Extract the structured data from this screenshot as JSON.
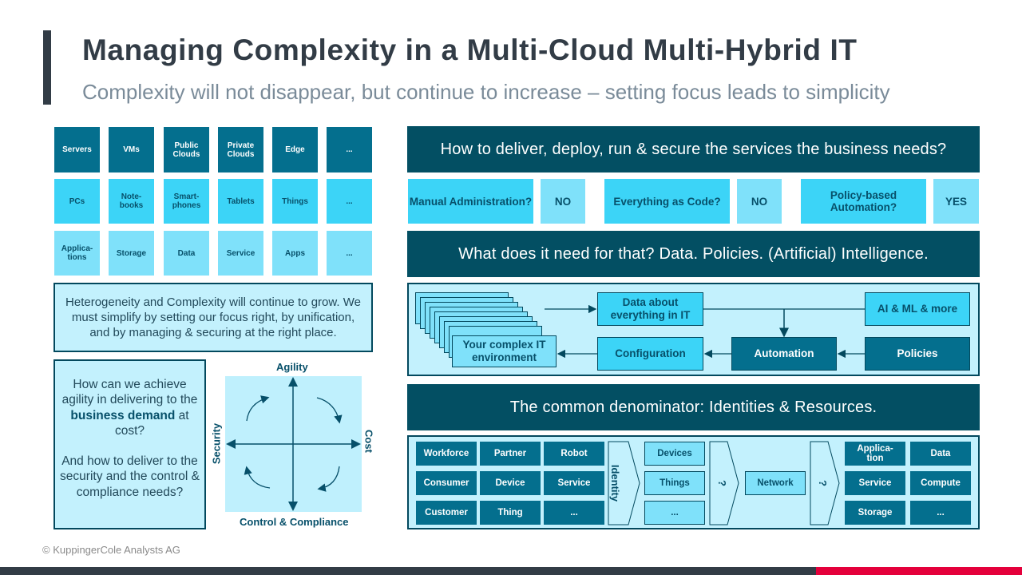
{
  "header": {
    "title": "Managing Complexity in a Multi-Cloud Multi-Hybrid IT",
    "subtitle": "Complexity will not disappear, but continue to increase – setting focus leads to simplicity"
  },
  "tiles": {
    "row1": [
      "Servers",
      "VMs",
      "Public\nClouds",
      "Private\nClouds",
      "Edge",
      "..."
    ],
    "row2": [
      "PCs",
      "Note-\nbooks",
      "Smart-\nphones",
      "Tablets",
      "Things",
      "..."
    ],
    "row3": [
      "Applica-\ntions",
      "Storage",
      "Data",
      "Service",
      "Apps",
      "..."
    ]
  },
  "note": "Heterogeneity and Complexity will continue to grow. We must simplify by setting our focus right, by unification, and by managing & securing at the right place.",
  "question": {
    "part1_before": "How can we achieve agility in delivering to the ",
    "part1_bold": "business demand",
    "part1_after": " at cost?",
    "part2": "And how to deliver to the security and the control & compliance needs?"
  },
  "quadrant": {
    "top": "Agility",
    "bottom": "Control & Compliance",
    "left": "Security",
    "right": "Cost"
  },
  "banners": {
    "deliver": "How to deliver, deploy, run & secure the services the business needs?",
    "need": "What does it need for that? Data. Policies. (Artificial) Intelligence.",
    "denominator": "The common denominator: Identities & Resources."
  },
  "approaches": [
    {
      "question": "Manual Administration?",
      "answer": "NO"
    },
    {
      "question": "Everything as Code?",
      "answer": "NO"
    },
    {
      "question": "Policy-based Automation?",
      "answer": "YES"
    }
  ],
  "flow": {
    "environment": "Your complex IT environment",
    "data": "Data about everything in IT",
    "ai": "AI & ML & more",
    "configuration": "Configuration",
    "automation": "Automation",
    "policies": "Policies"
  },
  "identities": {
    "grid": [
      [
        "Workforce",
        "Partner",
        "Robot"
      ],
      [
        "Consumer",
        "Device",
        "Service"
      ],
      [
        "Customer",
        "Thing",
        "..."
      ]
    ],
    "identity_label": "Identity",
    "devices": [
      "Devices",
      "Things",
      "..."
    ],
    "unknown1": "?",
    "network": "Network",
    "unknown2": "?",
    "resources": [
      [
        "Applica-\ntion",
        "Data"
      ],
      [
        "Service",
        "Compute"
      ],
      [
        "Storage",
        "..."
      ]
    ]
  },
  "footer": {
    "copyright": "© KuppingerCole Analysts AG"
  },
  "colors": {
    "dark_teal": "#034f63",
    "mid_teal": "#046f8e",
    "cyan": "#3cd4f7",
    "pale_cyan": "#7fe1fa",
    "panel_bg": "#c3f1fd",
    "title": "#323c46",
    "accent_red": "#e4003b"
  }
}
